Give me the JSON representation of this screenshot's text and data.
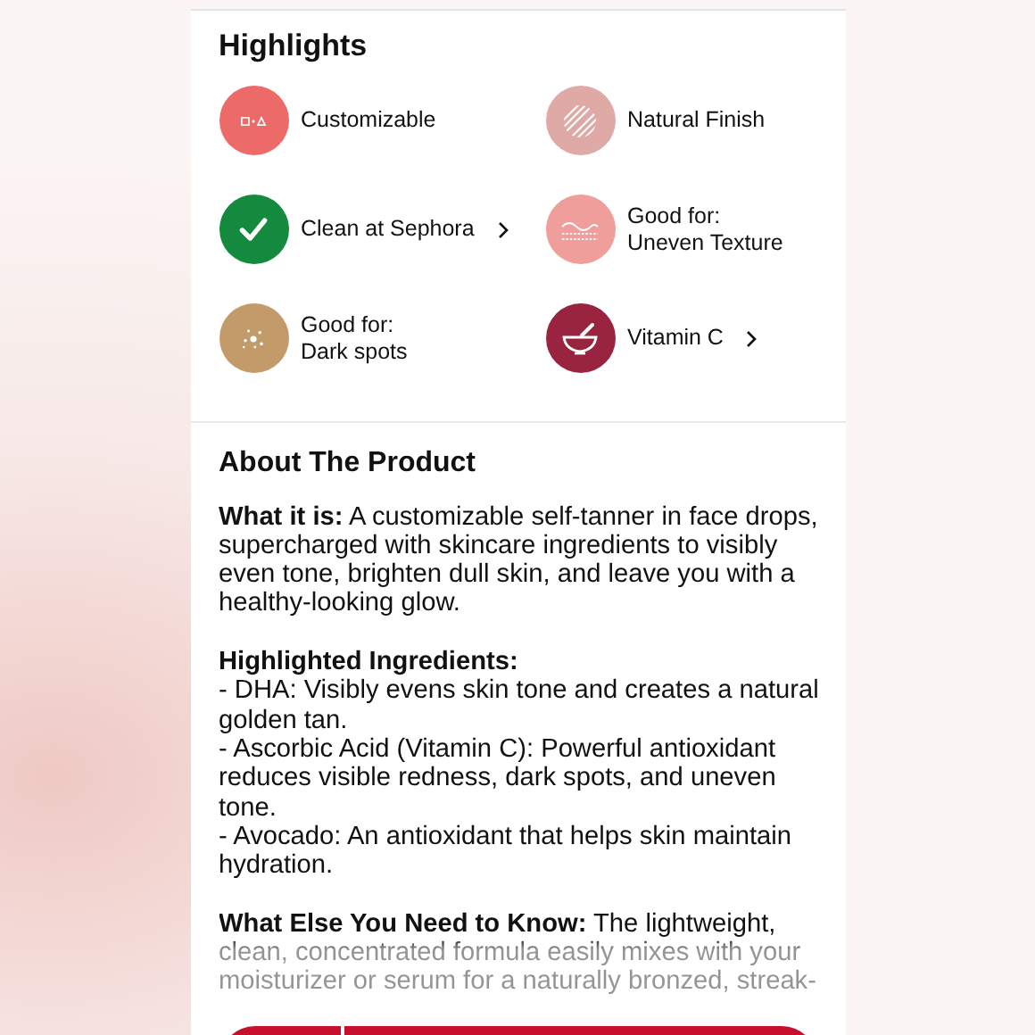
{
  "highlights": {
    "title": "Highlights",
    "items": [
      {
        "lines": [
          "Customizable"
        ],
        "color": "#ec6b68",
        "link": false
      },
      {
        "lines": [
          "Natural Finish"
        ],
        "color": "#dfaaa6",
        "link": false
      },
      {
        "lines": [
          "Clean at Sephora"
        ],
        "color": "#148a3e",
        "link": true
      },
      {
        "lines": [
          "Good for:",
          "Uneven Texture"
        ],
        "color": "#ef9e9b",
        "link": false
      },
      {
        "lines": [
          "Good for:",
          "Dark spots"
        ],
        "color": "#c39a6a",
        "link": false
      },
      {
        "lines": [
          "Vitamin C"
        ],
        "color": "#98243f",
        "link": true
      }
    ]
  },
  "about": {
    "title": "About The Product",
    "paragraphs": [
      {
        "text": "**What it is:** A customizable self-tanner in face drops, supercharged with skincare ingredients to visibly even tone, brighten dull skin, and leave you with a healthy-looking glow.",
        "faded": false
      },
      {
        "heading": "Highlighted Ingredients:",
        "lines": [
          "- DHA: Visibly evens skin tone and creates a natural golden tan.",
          "- Ascorbic Acid (Vitamin C): Powerful antioxidant reduces visible redness, dark spots, and uneven tone.",
          "- Avocado: An antioxidant that helps skin maintain hydration."
        ]
      },
      {
        "text": "**What Else You Need to Know:** The lightweight, clean, concentrated formula easily mixes with your moisturizer or serum for a naturally bronzed, streak-",
        "faded": true
      }
    ]
  }
}
